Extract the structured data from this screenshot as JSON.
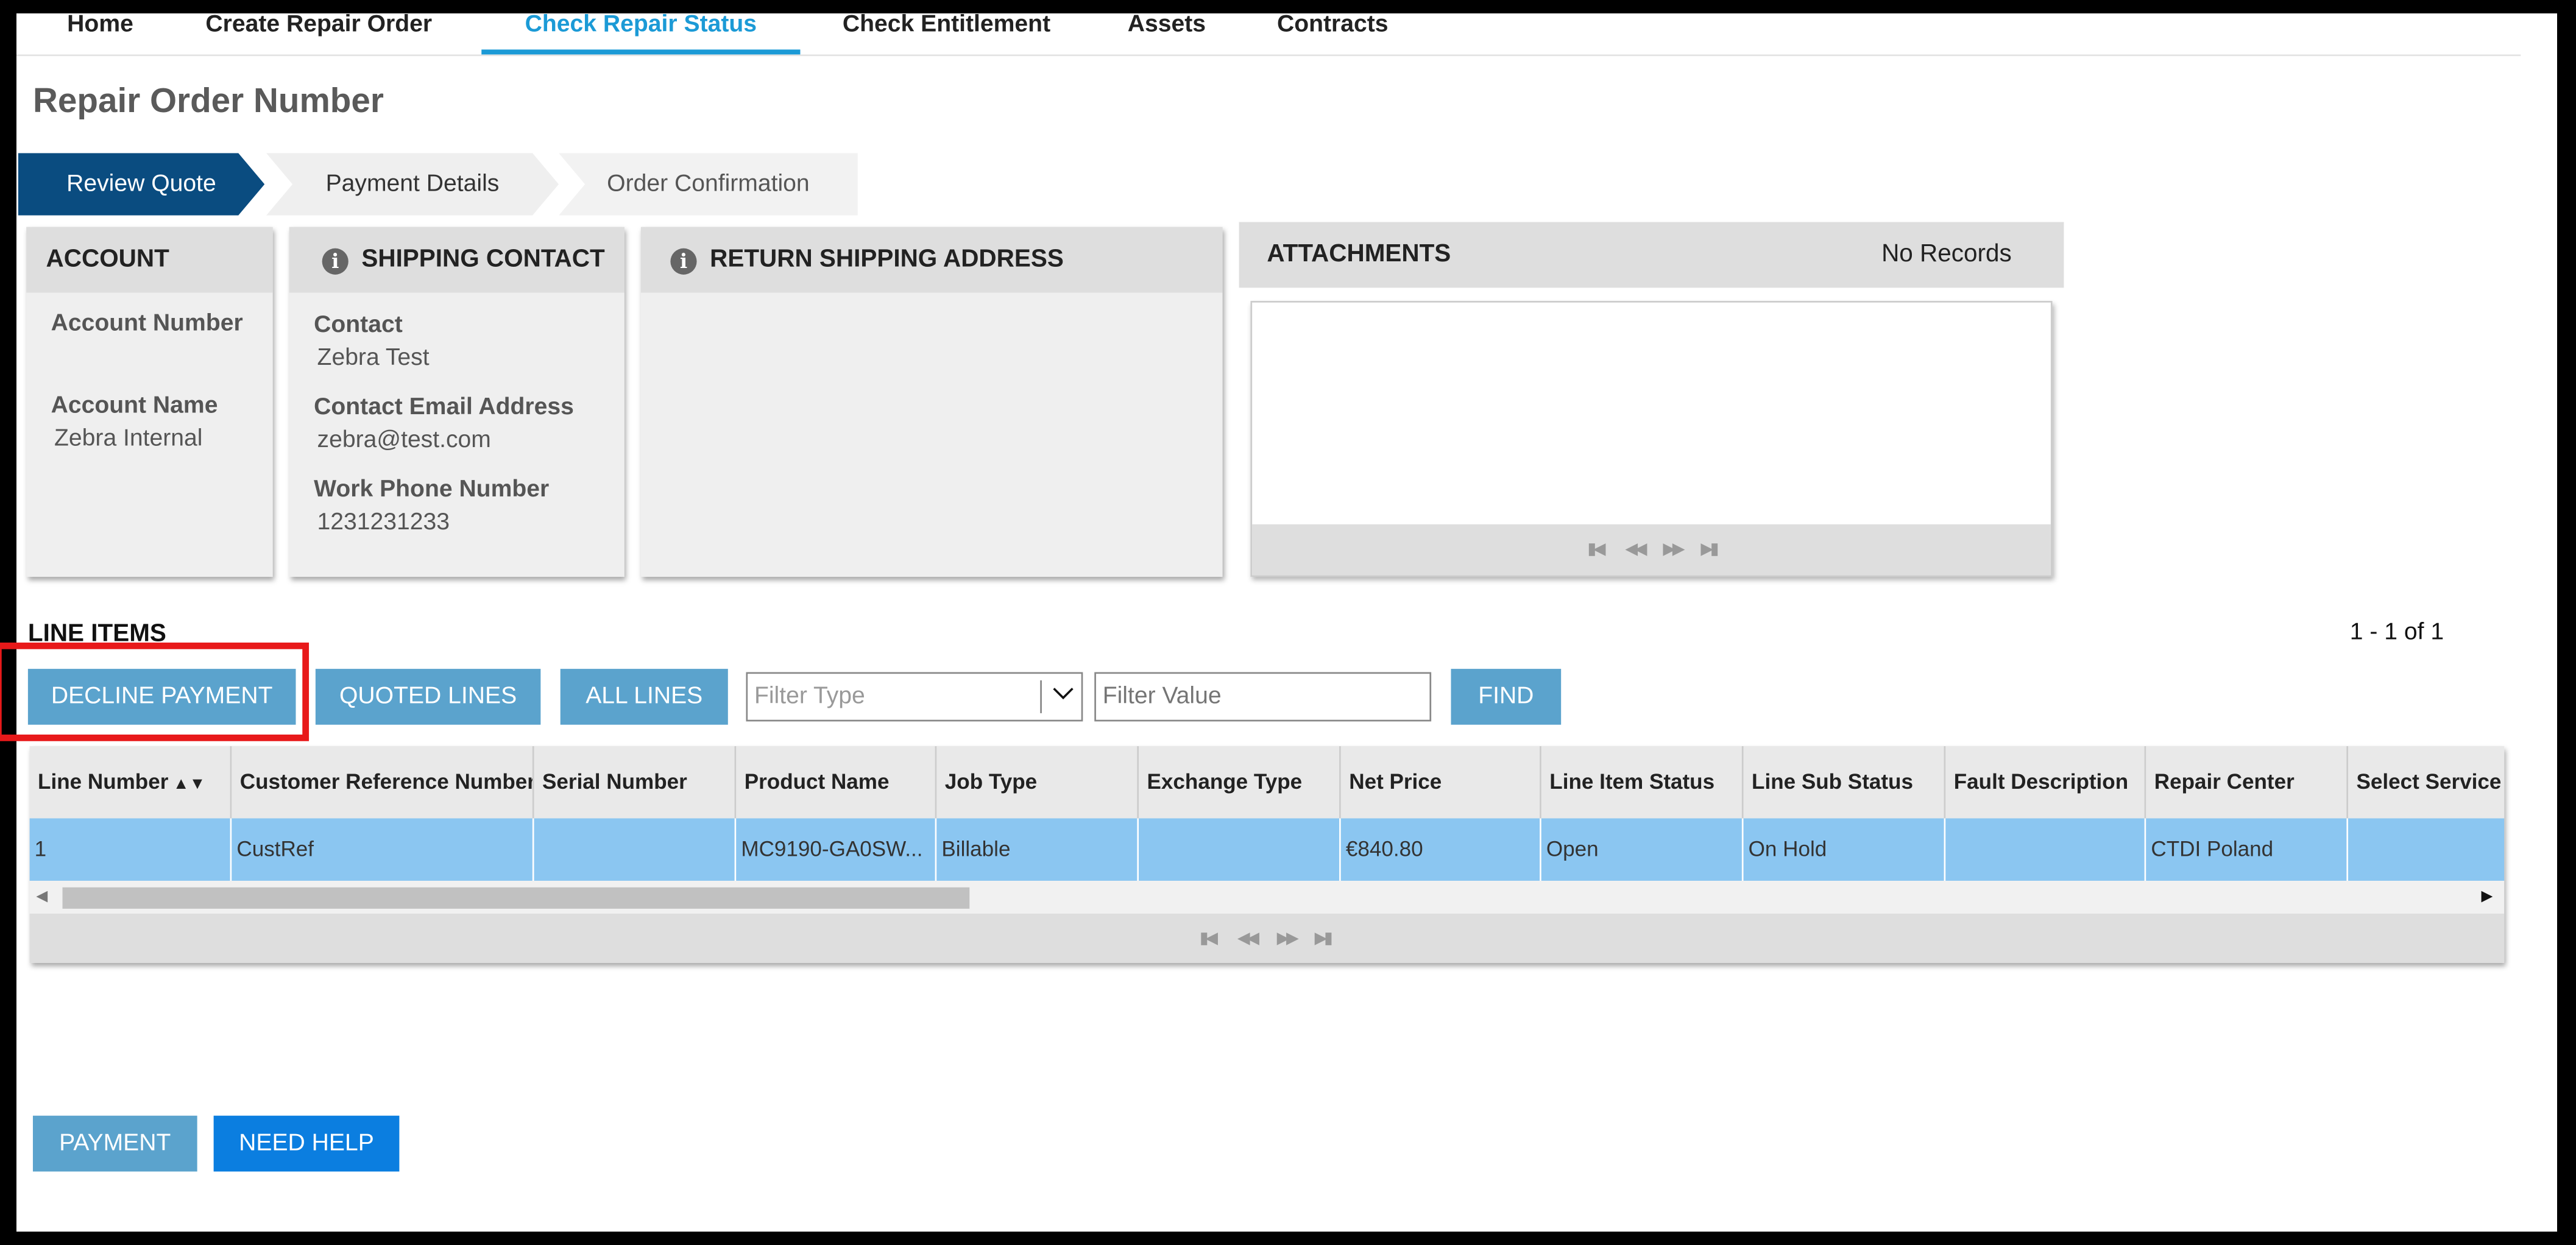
{
  "nav": {
    "tabs": [
      {
        "label": "Home"
      },
      {
        "label": "Create Repair Order"
      },
      {
        "label": "Check Repair Status"
      },
      {
        "label": "Check Entitlement"
      },
      {
        "label": "Assets"
      },
      {
        "label": "Contracts"
      }
    ],
    "active_tab": "Check Repair Status"
  },
  "page_title": "Repair Order Number",
  "steps": [
    "Review Quote",
    "Payment Details",
    "Order Confirmation"
  ],
  "account": {
    "title": "ACCOUNT",
    "account_number_label": "Account Number",
    "account_number_value": "",
    "account_name_label": "Account Name",
    "account_name_value": "Zebra Internal"
  },
  "shipping_contact": {
    "title": "SHIPPING CONTACT",
    "contact_label": "Contact",
    "contact_value": "Zebra Test",
    "email_label": "Contact Email Address",
    "email_value": "zebra@test.com",
    "phone_label": "Work Phone Number",
    "phone_value": "1231231233"
  },
  "return_shipping": {
    "title": "RETURN SHIPPING ADDRESS"
  },
  "attachments": {
    "title": "ATTACHMENTS",
    "status": "No Records"
  },
  "line_items": {
    "title": "LINE ITEMS",
    "count": "1 - 1 of 1",
    "buttons": {
      "decline": "DECLINE PAYMENT",
      "quoted": "QUOTED LINES",
      "all": "ALL LINES",
      "find": "FIND"
    },
    "filter_type_placeholder": "Filter Type",
    "filter_value_placeholder": "Filter Value",
    "columns": [
      "Line Number",
      "Customer Reference Number",
      "Serial Number",
      "Product Name",
      "Job Type",
      "Exchange Type",
      "Net Price",
      "Line Item Status",
      "Line Sub Status",
      "Fault Description",
      "Repair Center",
      "Select Service"
    ],
    "rows": [
      [
        "1",
        "CustRef",
        "",
        "MC9190-GA0SW...",
        "Billable",
        "",
        "€840.80",
        "Open",
        "On Hold",
        "",
        "CTDI Poland",
        ""
      ]
    ]
  },
  "footer_buttons": {
    "payment": "PAYMENT",
    "help": "NEED HELP"
  },
  "colors": {
    "accent": "#1b9ad6",
    "step_active": "#0a4c80",
    "button": "#5ba3cd",
    "button_primary": "#0b7ee0",
    "row_selected": "#8bc6f1",
    "highlight": "#e8191a"
  }
}
